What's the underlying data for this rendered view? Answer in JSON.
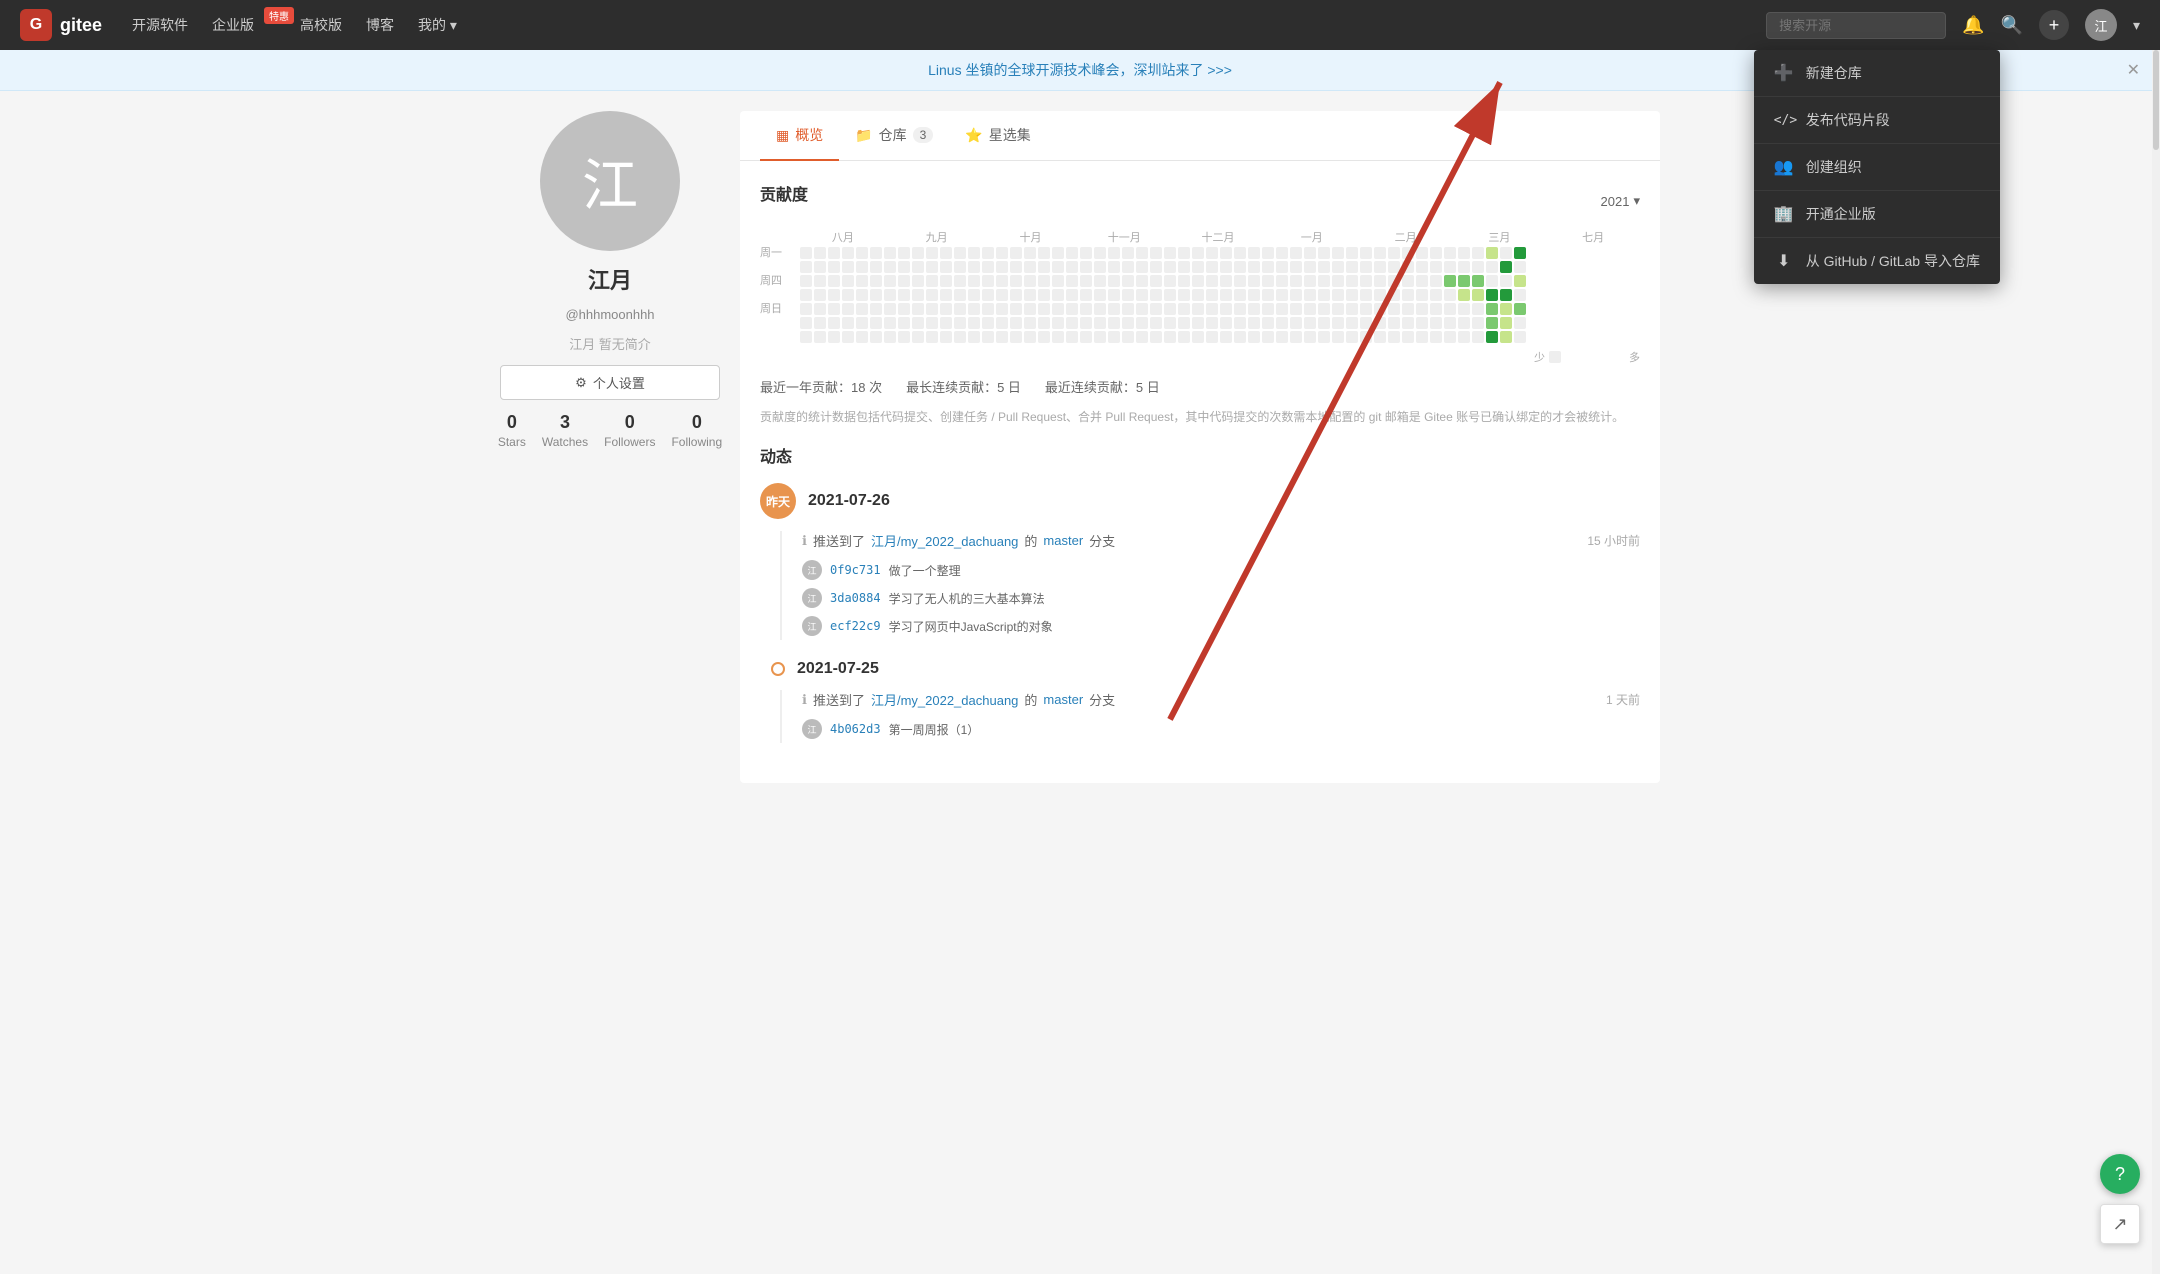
{
  "nav": {
    "logo_text": "gitee",
    "logo_icon": "G",
    "items": [
      {
        "label": "开源软件",
        "badge": null
      },
      {
        "label": "企业版",
        "badge": "特惠"
      },
      {
        "label": "高校版",
        "badge": null
      },
      {
        "label": "博客",
        "badge": null
      },
      {
        "label": "我的",
        "badge": null,
        "has_arrow": true
      }
    ],
    "search_placeholder": "搜索开源",
    "plus_label": "+",
    "avatar_label": "江"
  },
  "announce": {
    "text": "Linus 坐镇的全球开源技术峰会，深圳站来了 >>>"
  },
  "sidebar": {
    "avatar_char": "江",
    "username": "江月",
    "handle": "@hhhmoonhhh",
    "bio": "江月 暂无简介",
    "settings_btn": "个人设置",
    "stats": [
      {
        "number": "0",
        "label": "Stars"
      },
      {
        "number": "3",
        "label": "Watches"
      },
      {
        "number": "0",
        "label": "Followers"
      },
      {
        "number": "0",
        "label": "Following"
      }
    ]
  },
  "tabs": [
    {
      "label": "概览",
      "icon": "▦",
      "active": true
    },
    {
      "label": "仓库",
      "icon": "📁",
      "count": "3"
    },
    {
      "label": "星选集",
      "icon": "⭐",
      "count": null
    }
  ],
  "contribution": {
    "title": "贡献度",
    "year": "2021",
    "months": [
      "八月",
      "九月",
      "十月",
      "十一月",
      "十二月",
      "一月",
      "二月",
      "三月",
      "七月"
    ],
    "day_labels": [
      "周一",
      "",
      "周四",
      "",
      "周日"
    ],
    "stats_recent_year": "最近一年贡献：18 次",
    "stats_longest_streak": "最长连续贡献：5 日",
    "stats_current_streak": "最近连续贡献：5 日",
    "note": "贡献度的统计数据包括代码提交、创建任务 / Pull Request、合并 Pull Request，其中代码提交的次数需本地配置的 git 邮箱是 Gitee 账号已确认绑定的才会被统计。",
    "legend_less": "少",
    "legend_more": "多"
  },
  "activity": {
    "title": "动态",
    "groups": [
      {
        "badge": "昨天",
        "date": "2021-07-26",
        "items": [
          {
            "type": "push",
            "text_prefix": "推送到了",
            "repo": "江月/my_2022_dachuang",
            "branch": "master",
            "time": "15 小时前",
            "commits": [
              {
                "hash": "0f9c731",
                "message": "做了一个整理",
                "avatar": "江"
              },
              {
                "hash": "3da0884",
                "message": "学习了无人机的三大基本算法",
                "avatar": "江"
              },
              {
                "hash": "ecf22c9",
                "message": "学习了网页中JavaScript的对象",
                "avatar": "江"
              }
            ]
          }
        ]
      },
      {
        "badge": "○",
        "date": "2021-07-25",
        "items": [
          {
            "type": "push",
            "text_prefix": "推送到了",
            "repo": "江月/my_2022_dachuang",
            "branch": "master",
            "time": "1 天前",
            "commits": [
              {
                "hash": "4b062d3",
                "message": "第一周周报（1）",
                "avatar": "江"
              }
            ]
          }
        ]
      }
    ]
  },
  "dropdown": {
    "items": [
      {
        "icon": "➕",
        "label": "新建仓库"
      },
      {
        "icon": "</>",
        "label": "发布代码片段"
      },
      {
        "icon": "👥",
        "label": "创建组织"
      },
      {
        "icon": "🏢",
        "label": "开通企业版"
      },
      {
        "icon": "⬇",
        "label": "从 GitHub / GitLab 导入仓库"
      }
    ]
  }
}
